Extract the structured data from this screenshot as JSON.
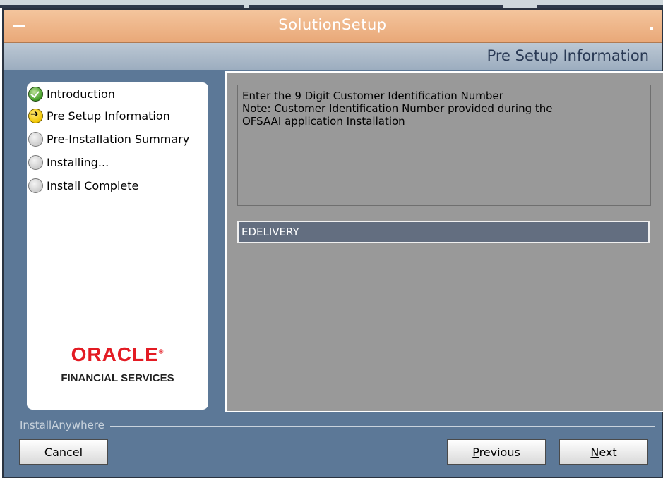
{
  "window": {
    "title": "SolutionSetup"
  },
  "header": {
    "page_title": "Pre Setup Information"
  },
  "steps": [
    {
      "label": "Introduction",
      "status": "done",
      "icon": "check-circle-icon"
    },
    {
      "label": "Pre Setup Information",
      "status": "current",
      "icon": "arrow-circle-icon"
    },
    {
      "label": "Pre-Installation Summary",
      "status": "pending",
      "icon": "circle-icon"
    },
    {
      "label": "Installing...",
      "status": "pending",
      "icon": "circle-icon"
    },
    {
      "label": "Install Complete",
      "status": "pending",
      "icon": "circle-icon"
    }
  ],
  "branding": {
    "logo": "ORACLE",
    "registered_mark": "®",
    "subtitle": "FINANCIAL SERVICES",
    "logo_color": "#e31b23"
  },
  "content": {
    "info_lines": [
      "Enter the 9 Digit Customer Identification Number",
      "Note: Customer Identification Number provided during the",
      "OFSAAI application Installation"
    ],
    "customer_id_value": "EDELIVERY"
  },
  "footer": {
    "installer_label": "InstallAnywhere",
    "cancel_label": "Cancel",
    "previous_mnemonic": "P",
    "previous_rest": "revious",
    "next_mnemonic": "N",
    "next_rest": "ext"
  },
  "colors": {
    "title_bar": "#e9a878",
    "window_bg": "#5c7897",
    "content_bg": "#999999",
    "input_bg": "#636e80"
  }
}
